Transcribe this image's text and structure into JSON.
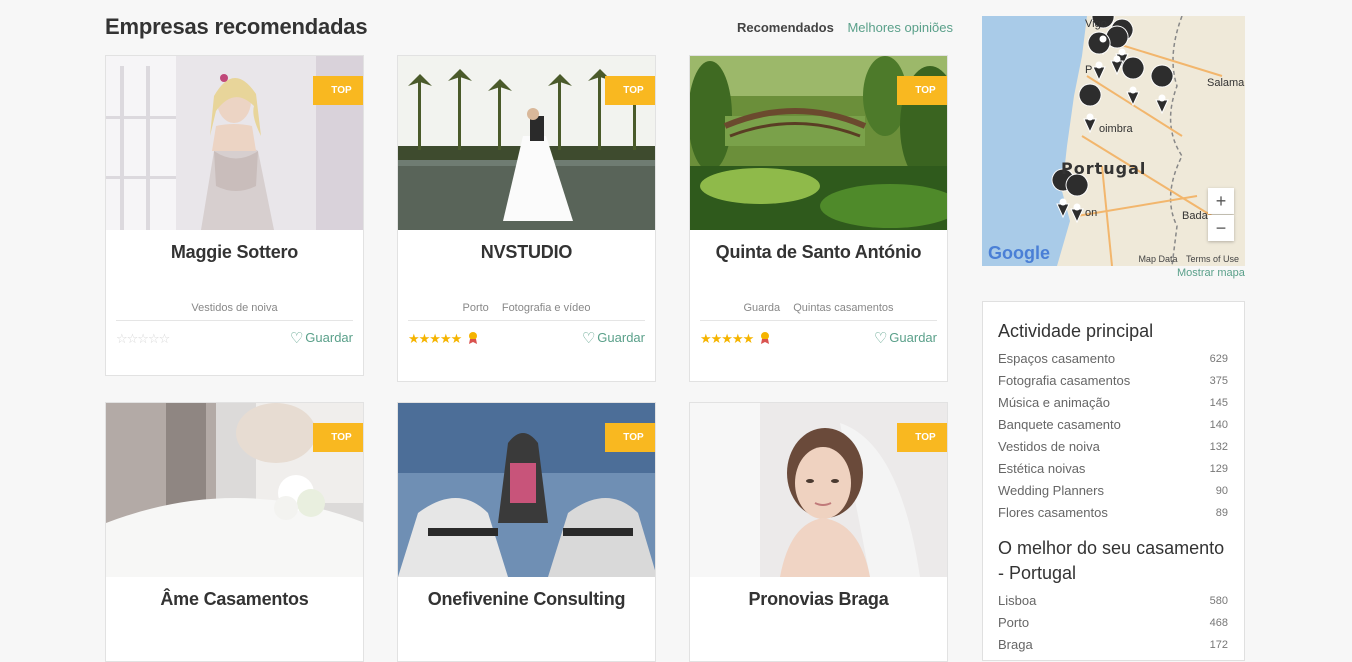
{
  "section": {
    "title": "Empresas recomendadas"
  },
  "sort_tabs": [
    "Recomendados",
    "Melhores opiniões"
  ],
  "badge_label": "TOP",
  "save_label": "Guardar",
  "cards": [
    {
      "name": "Maggie Sottero",
      "location": "",
      "category": "Vestidos de noiva",
      "rating": 0,
      "medal": false
    },
    {
      "name": "NVSTUDIO",
      "location": "Porto",
      "category": "Fotografia e vídeo",
      "rating": 5,
      "medal": true
    },
    {
      "name": "Quinta de Santo António",
      "location": "Guarda",
      "category": "Quintas casamentos",
      "rating": 5,
      "medal": true
    },
    {
      "name": "Âme Casamentos",
      "location": "",
      "category": "",
      "rating": null,
      "medal": false
    },
    {
      "name": "Onefivenine Consulting",
      "location": "",
      "category": "",
      "rating": null,
      "medal": false
    },
    {
      "name": "Pronovias Braga",
      "location": "",
      "category": "",
      "rating": null,
      "medal": false
    }
  ],
  "map": {
    "labels": {
      "vigo": "Vigo",
      "porto": "P",
      "salamanca": "Salama",
      "coimbra": "oimbra",
      "country": "Portugal",
      "lisbon": "on",
      "badajoz": "Bada"
    },
    "zoom_in": "+",
    "zoom_out": "−",
    "logo": "Google",
    "map_data": "Map Data",
    "terms": "Terms of Use",
    "show_map": "Mostrar mapa"
  },
  "activity": {
    "title": "Actividade principal",
    "items": [
      {
        "label": "Espaços casamento",
        "count": "629"
      },
      {
        "label": "Fotografia casamentos",
        "count": "375"
      },
      {
        "label": "Música e animação",
        "count": "145"
      },
      {
        "label": "Banquete casamento",
        "count": "140"
      },
      {
        "label": "Vestidos de noiva",
        "count": "132"
      },
      {
        "label": "Estética noivas",
        "count": "129"
      },
      {
        "label": "Wedding Planners",
        "count": "90"
      },
      {
        "label": "Flores casamentos",
        "count": "89"
      }
    ]
  },
  "best": {
    "title": "O melhor do seu casamento - Portugal",
    "items": [
      {
        "label": "Lisboa",
        "count": "580"
      },
      {
        "label": "Porto",
        "count": "468"
      },
      {
        "label": "Braga",
        "count": "172"
      }
    ]
  },
  "colors": {
    "accent": "#5aa08a",
    "badge": "#f9b820",
    "star": "#f5b400"
  }
}
